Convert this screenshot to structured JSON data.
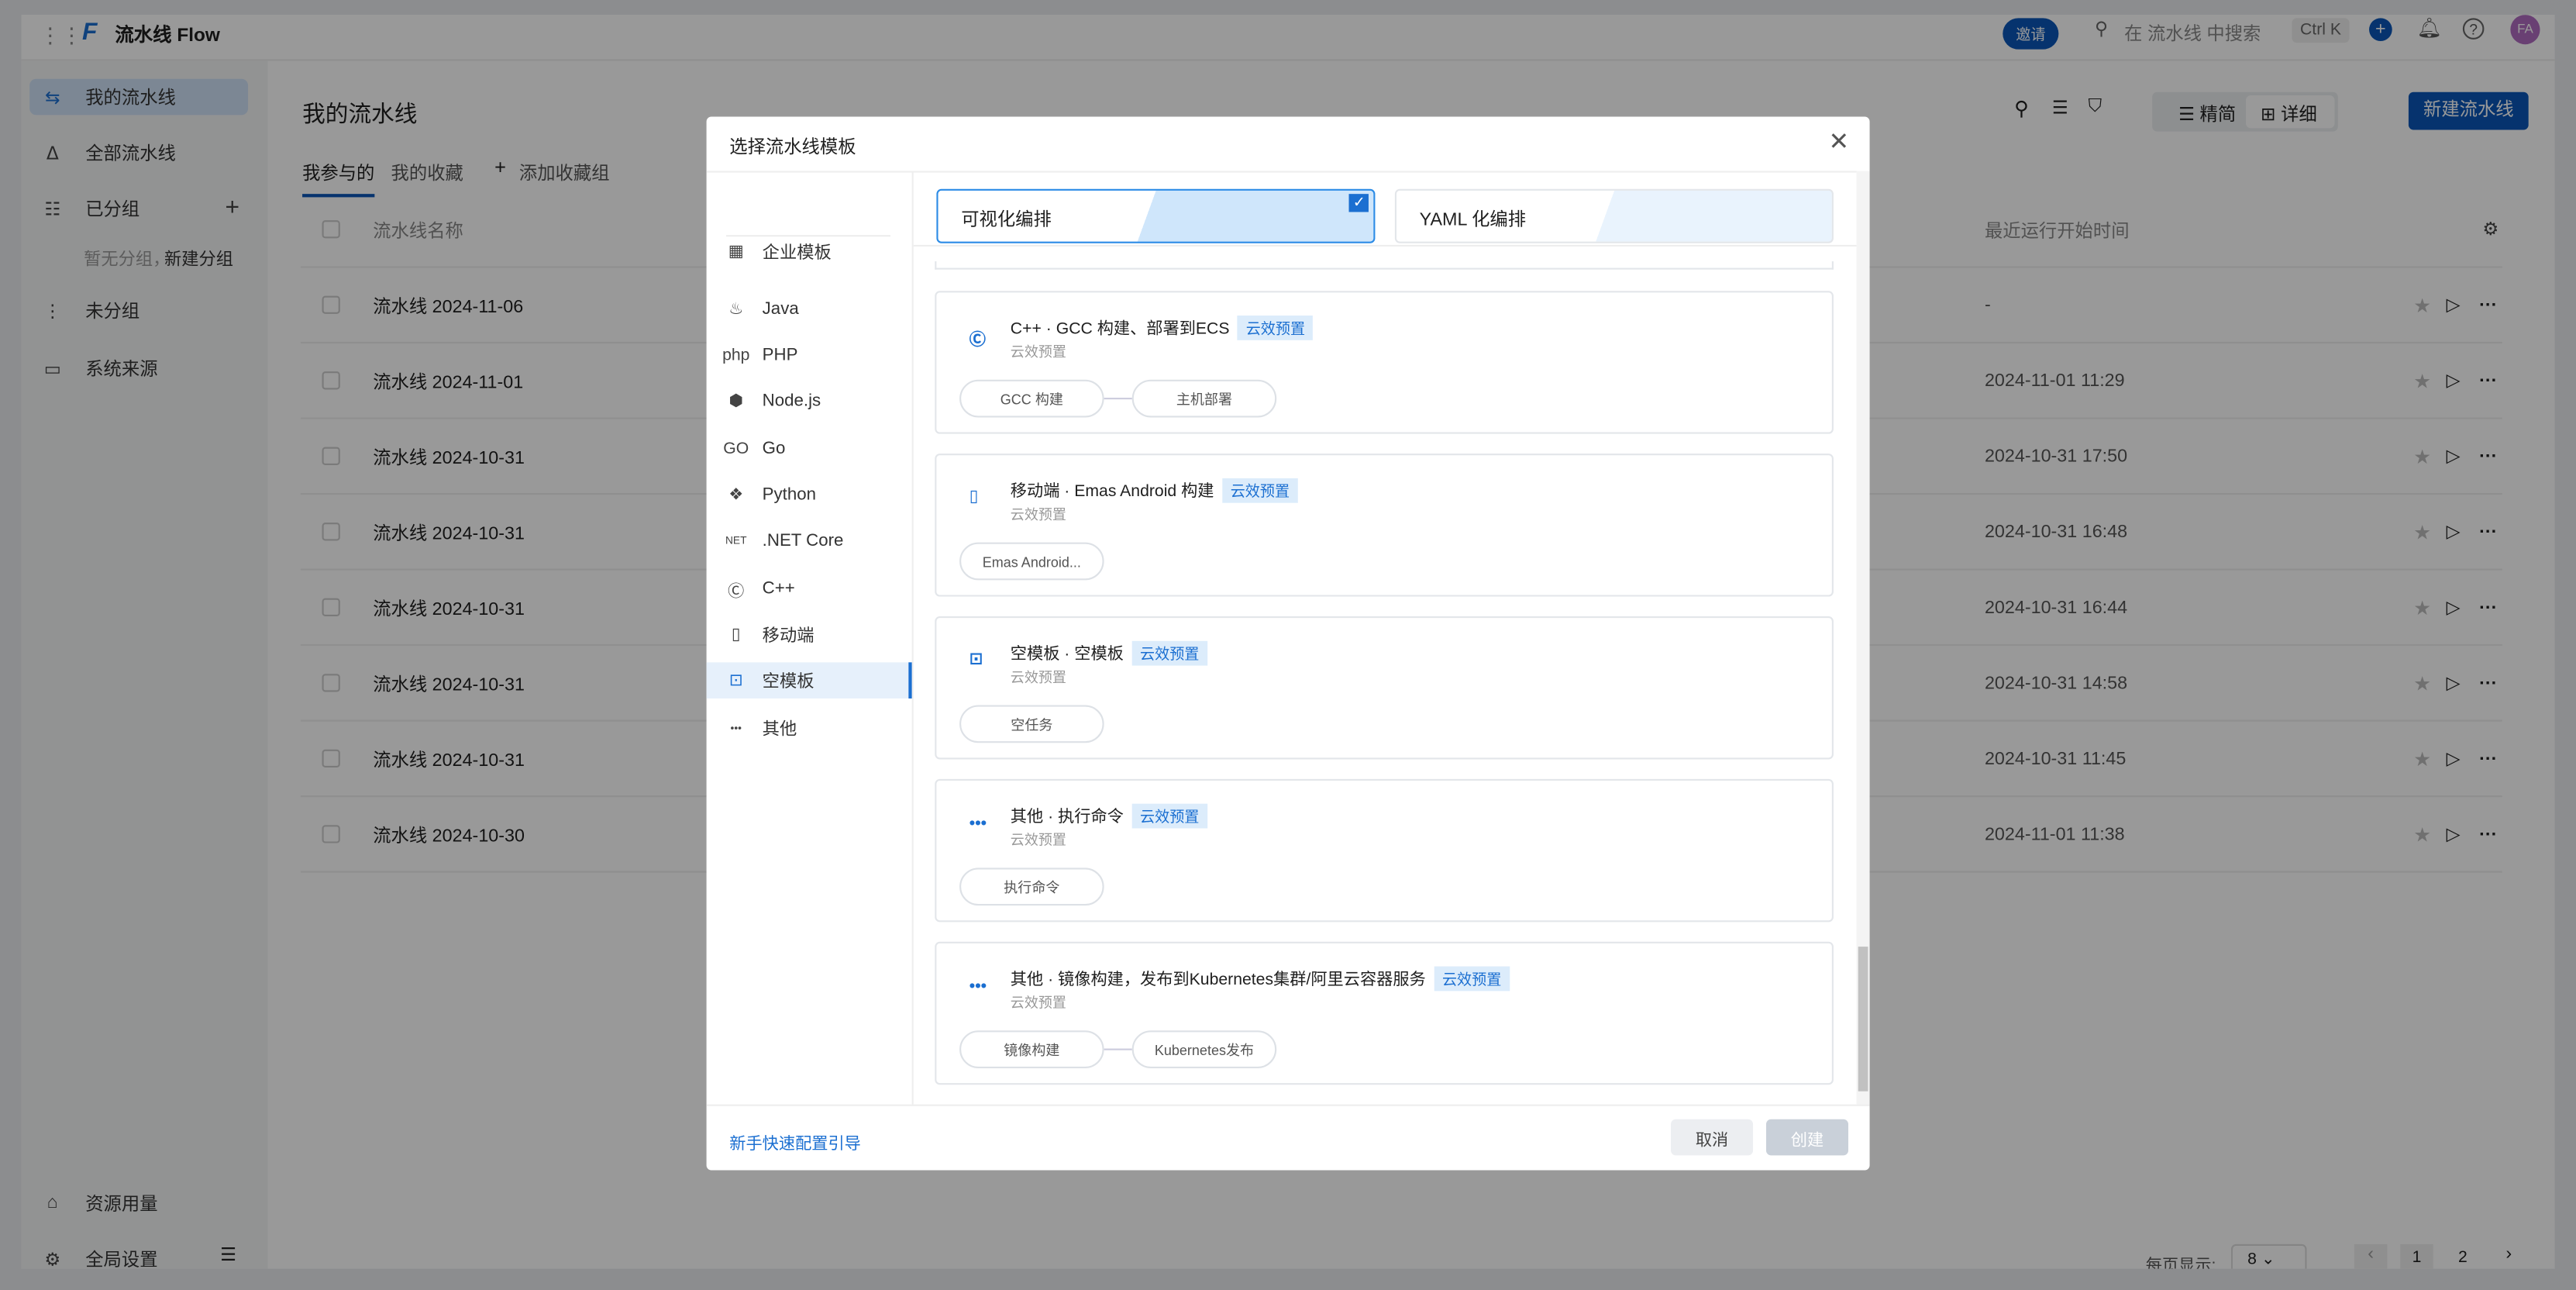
{
  "topbar": {
    "app_name": "流水线 Flow",
    "invite": "邀请",
    "search_placeholder": "在 流水线 中搜索",
    "shortcut": "Ctrl K",
    "avatar": "FA"
  },
  "sidebar": {
    "items": [
      {
        "label": "我的流水线",
        "icon": "swap-icon"
      },
      {
        "label": "全部流水线",
        "icon": "nodes-icon"
      },
      {
        "label": "已分组",
        "icon": "list-icon"
      },
      {
        "label": "未分组",
        "icon": "ungrouped-icon"
      },
      {
        "label": "系统来源",
        "icon": "monitor-icon"
      }
    ],
    "empty_hint": "暂无分组，",
    "create_group": "新建分组",
    "bottom": [
      {
        "label": "资源用量",
        "icon": "inbox-icon"
      },
      {
        "label": "全局设置",
        "icon": "gear-icon"
      }
    ]
  },
  "main": {
    "title": "我的流水线",
    "tabs": [
      "我参与的",
      "我的收藏"
    ],
    "add_group": "添加收藏组",
    "view_simple": "精简",
    "view_detail": "详细",
    "new_pipeline": "新建流水线",
    "columns": {
      "name": "流水线名称",
      "last_run": "最近运行开始时间"
    },
    "rows": [
      {
        "name": "流水线 2024-11-06",
        "time": "-"
      },
      {
        "name": "流水线 2024-11-01",
        "time": "2024-11-01 11:29"
      },
      {
        "name": "流水线 2024-10-31",
        "time": "2024-10-31 17:50"
      },
      {
        "name": "流水线 2024-10-31",
        "time": "2024-10-31 16:48"
      },
      {
        "name": "流水线 2024-10-31",
        "time": "2024-10-31 16:44"
      },
      {
        "name": "流水线 2024-10-31",
        "time": "2024-10-31 14:58"
      },
      {
        "name": "流水线 2024-10-31",
        "time": "2024-10-31 11:45"
      },
      {
        "name": "流水线 2024-10-30",
        "time": "2024-11-01 11:38"
      }
    ],
    "pagination": {
      "per_page_label": "每页显示:",
      "per_page": "8",
      "pages": [
        "1",
        "2"
      ],
      "current": "1"
    }
  },
  "modal": {
    "title": "选择流水线模板",
    "nav": [
      {
        "label": "企业模板",
        "icon": "grid-icon"
      },
      {
        "label": "Java",
        "icon": "java-icon"
      },
      {
        "label": "PHP",
        "icon": "php-icon"
      },
      {
        "label": "Node.js",
        "icon": "nodejs-icon"
      },
      {
        "label": "Go",
        "icon": "go-icon"
      },
      {
        "label": "Python",
        "icon": "python-icon"
      },
      {
        "label": ".NET Core",
        "icon": "dotnet-icon"
      },
      {
        "label": "C++",
        "icon": "cpp-icon"
      },
      {
        "label": "移动端",
        "icon": "mobile-icon"
      },
      {
        "label": "空模板",
        "icon": "empty-icon",
        "active": true
      },
      {
        "label": "其他",
        "icon": "more-icon"
      }
    ],
    "modes": [
      {
        "label": "可视化编排",
        "selected": true
      },
      {
        "label": "YAML 化编排",
        "selected": false
      }
    ],
    "templates": [
      {
        "title": "C++ · GCC 构建、部署到ECS",
        "tag": "云效预置",
        "sub": "云效预置",
        "steps": [
          "GCC 构建",
          "主机部署"
        ],
        "icon": "cpp-icon"
      },
      {
        "title": "移动端 · Emas Android 构建",
        "tag": "云效预置",
        "sub": "云效预置",
        "steps": [
          "Emas Android..."
        ],
        "icon": "mobile-icon"
      },
      {
        "title": "空模板 · 空模板",
        "tag": "云效预置",
        "sub": "云效预置",
        "steps": [
          "空任务"
        ],
        "icon": "empty-icon"
      },
      {
        "title": "其他 · 执行命令",
        "tag": "云效预置",
        "sub": "云效预置",
        "steps": [
          "执行命令"
        ],
        "icon": "more-icon"
      },
      {
        "title": "其他 · 镜像构建，发布到Kubernetes集群/阿里云容器服务",
        "tag": "云效预置",
        "sub": "云效预置",
        "steps": [
          "镜像构建",
          "Kubernetes发布"
        ],
        "icon": "more-icon"
      }
    ],
    "guide_link": "新手快速配置引导",
    "cancel": "取消",
    "create": "创建"
  },
  "colors": {
    "accent": "#1b6fd1",
    "primary_button": "#0a56b8",
    "avatar": "#b06cc0"
  }
}
